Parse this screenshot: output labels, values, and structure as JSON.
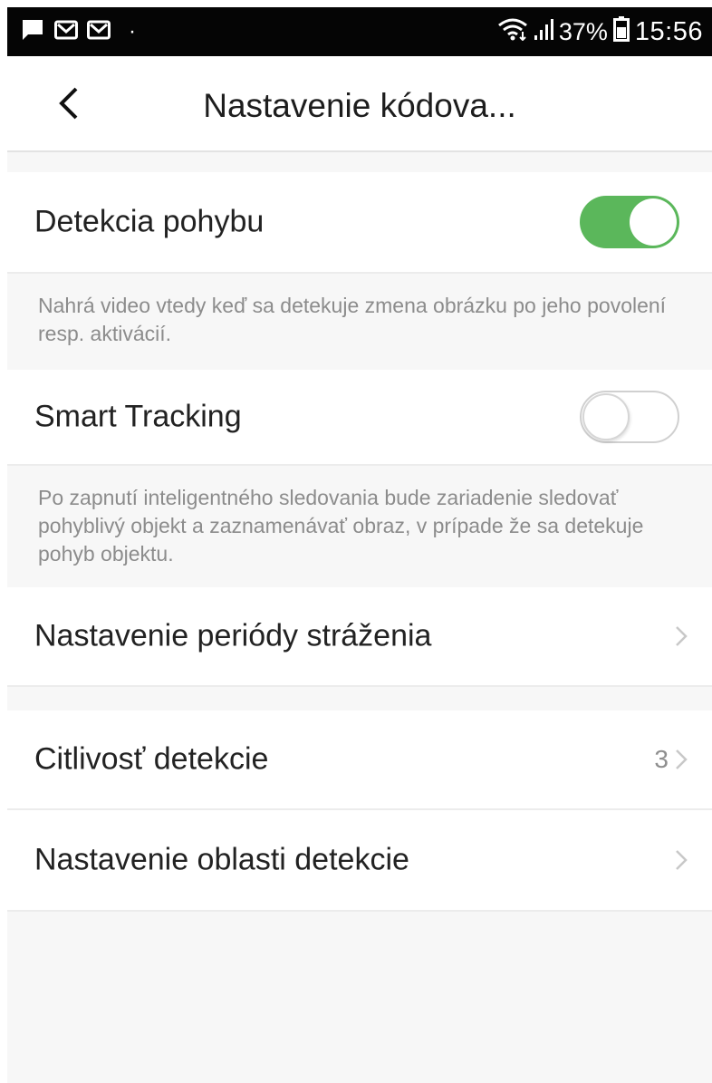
{
  "status_bar": {
    "icons": [
      "message-icon",
      "gmail-icon",
      "gmail-icon",
      "wifi-icon",
      "signal-icon",
      "battery-icon"
    ],
    "dot": "·",
    "battery": "37%",
    "time": "15:56"
  },
  "header": {
    "title": "Nastavenie kódova..."
  },
  "settings": {
    "motion_detection": {
      "label": "Detekcia pohybu",
      "enabled": true,
      "description": "Nahrá video vtedy keď sa detekuje zmena obrázku po jeho povolení resp. aktivácií."
    },
    "smart_tracking": {
      "label": "Smart Tracking",
      "enabled": false,
      "description": "Po zapnutí inteligentného sledovania bude zariadenie sledovať pohyblivý objekt a zaznamenávať obraz, v prípade že sa detekuje pohyb objektu."
    },
    "guard_period": {
      "label": "Nastavenie periódy stráženia"
    },
    "sensitivity": {
      "label": "Citlivosť detekcie",
      "value": "3"
    },
    "detection_area": {
      "label": "Nastavenie oblasti detekcie"
    }
  },
  "colors": {
    "toggle_on": "#5bb75b",
    "toggle_off_border": "#d0d0d0",
    "section_gap": "#f7f7f7"
  }
}
